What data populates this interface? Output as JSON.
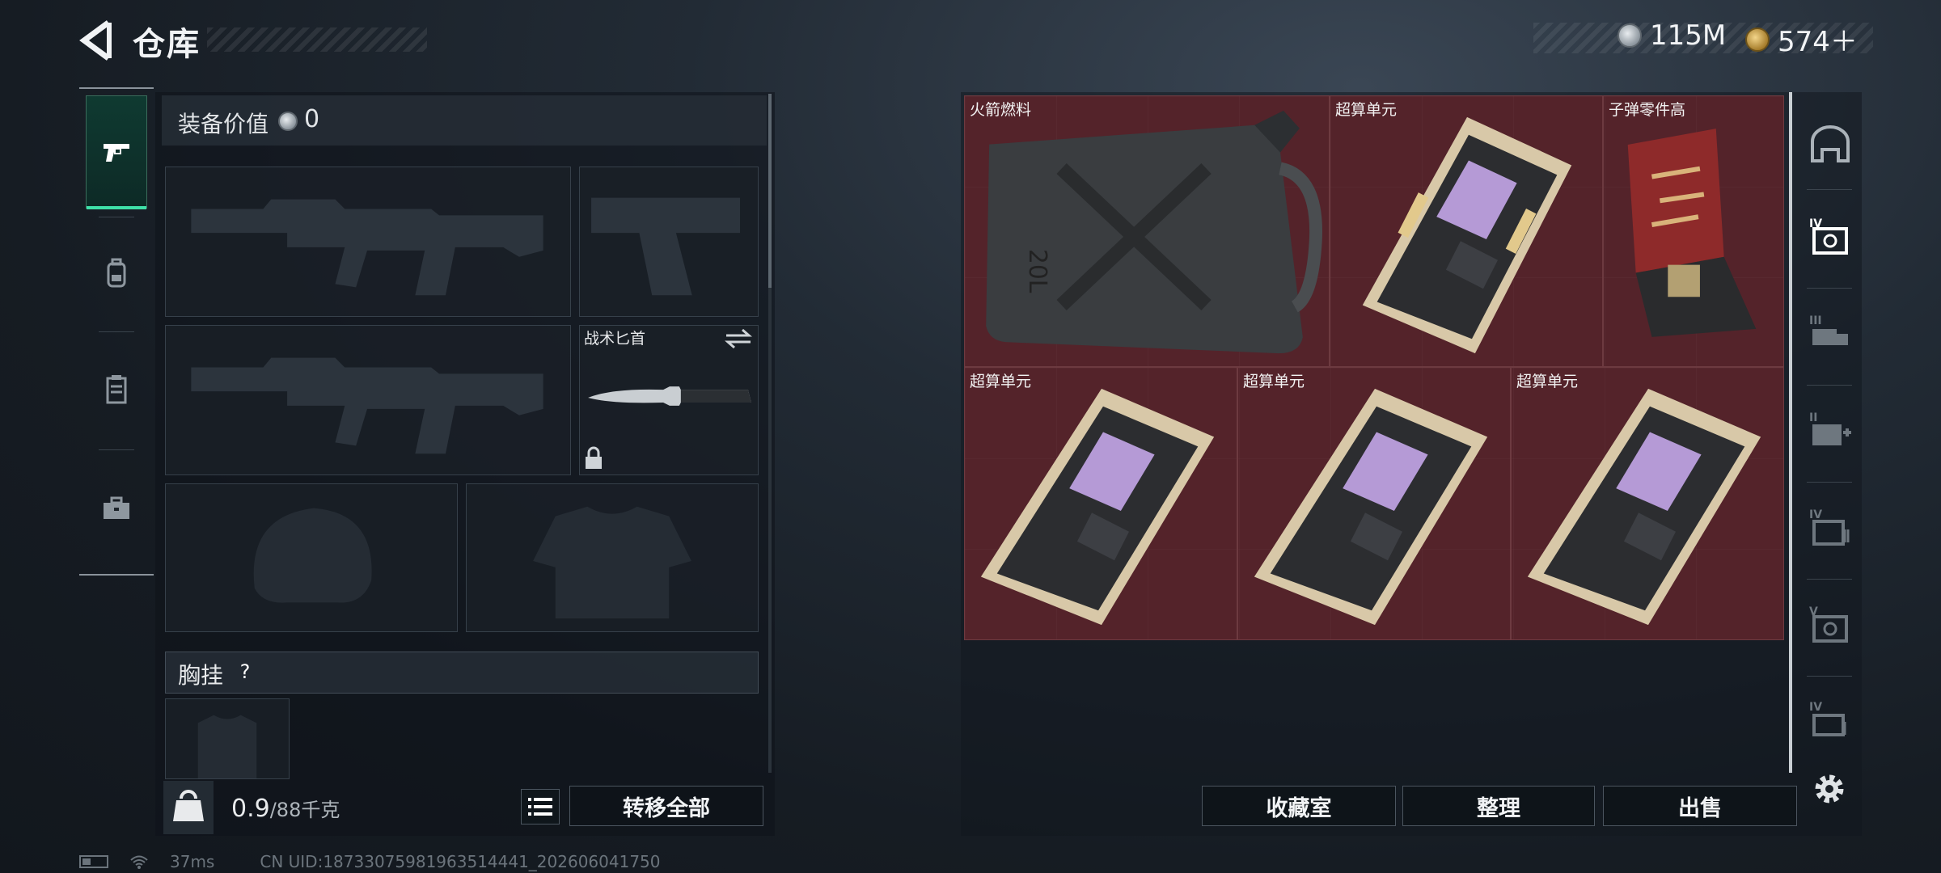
{
  "header": {
    "title": "仓库",
    "currency_silver": "115M",
    "currency_gold": "574＋"
  },
  "equipment": {
    "value_label": "装备价值",
    "value": "0",
    "melee_name": "战术匕首",
    "rig_label": "胸挂",
    "rig_help": "?",
    "weight_current": "0.9",
    "weight_max": "/88千克",
    "weight_icon_label": "KG",
    "transfer_all_label": "转移全部"
  },
  "storage": {
    "items": [
      {
        "name": "火箭燃料"
      },
      {
        "name": "超算单元"
      },
      {
        "name": "子弹零件高"
      },
      {
        "name": "超算单元"
      },
      {
        "name": "超算单元"
      },
      {
        "name": "超算单元"
      }
    ],
    "fuel_can_text": "20L"
  },
  "actions": {
    "collection_label": "收藏室",
    "organize_label": "整理",
    "sell_label": "出售"
  },
  "status_bar": {
    "ping": "37ms",
    "uid": "CN UID:18733075981963514441_202606041750"
  },
  "colors": {
    "accent": "#3ee0a8",
    "grid_bg": "#4a2228",
    "grid_border": "#6d3a40"
  },
  "icons": {
    "left_tabs": [
      "pistol-icon",
      "backpack-icon",
      "clipboard-icon",
      "briefcase-icon"
    ],
    "right_tabs": [
      "bunker-icon",
      "tier4-safe-icon",
      "tier3-truck-icon",
      "tier2-medkit-icon",
      "tier4-crate-icon",
      "tier5-safe-icon",
      "tier4-case-icon"
    ]
  }
}
